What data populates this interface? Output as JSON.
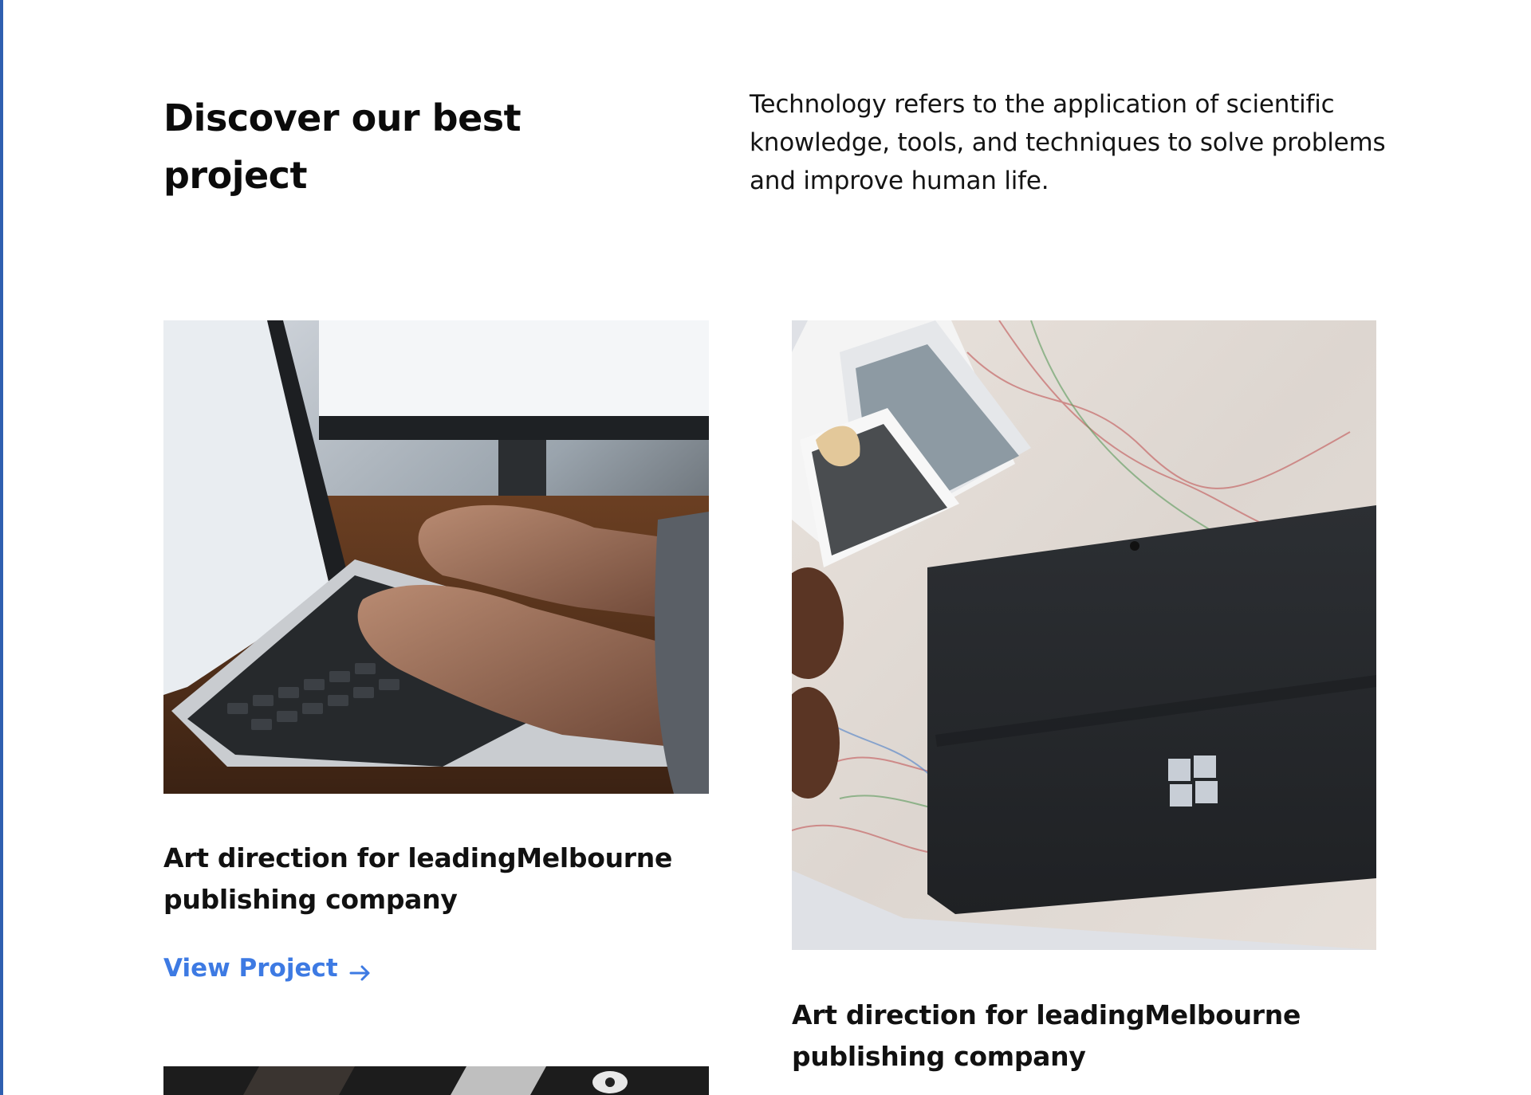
{
  "section": {
    "heading": "Discover our best project",
    "description": "Technology refers to the application of scientific knowledge, tools, and techniques to solve problems and improve human life."
  },
  "projects": [
    {
      "image_icon": "laptop-typing-photo",
      "title": "Art direction for leadingMelbourne publishing company",
      "link_label": "View Project"
    },
    {
      "image_icon": "tablet-on-map-photo",
      "title": "Art direction for leadingMelbourne publishing company"
    },
    {
      "image_icon": "project-photo"
    }
  ],
  "colors": {
    "accent": "#3d7ae3",
    "left_rule": "#2f5fb0"
  }
}
